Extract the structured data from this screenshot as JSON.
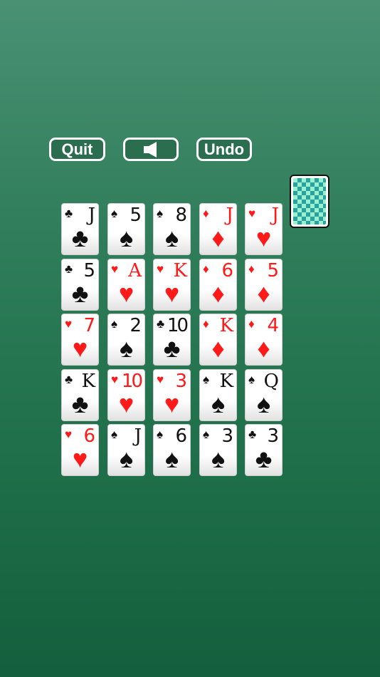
{
  "toolbar": {
    "quit_label": "Quit",
    "sound_icon": "speaker-icon",
    "undo_label": "Undo"
  },
  "deck": {
    "icon": "card-back-icon",
    "pattern_colors": [
      "#9bf0cf",
      "#2aa3a0"
    ]
  },
  "colors": {
    "red": "#ff1a1a",
    "black": "#111111",
    "felt": "#1e6e49"
  },
  "suit_symbols": {
    "clubs": "♣",
    "spades": "♠",
    "hearts": "♥",
    "diamonds": "♦"
  },
  "grid": [
    [
      {
        "rank": "J",
        "suit": "clubs"
      },
      {
        "rank": "5",
        "suit": "spades"
      },
      {
        "rank": "8",
        "suit": "spades"
      },
      {
        "rank": "J",
        "suit": "diamonds"
      },
      {
        "rank": "J",
        "suit": "hearts"
      }
    ],
    [
      {
        "rank": "5",
        "suit": "clubs"
      },
      {
        "rank": "A",
        "suit": "hearts"
      },
      {
        "rank": "K",
        "suit": "hearts"
      },
      {
        "rank": "6",
        "suit": "diamonds"
      },
      {
        "rank": "5",
        "suit": "diamonds"
      }
    ],
    [
      {
        "rank": "7",
        "suit": "hearts"
      },
      {
        "rank": "2",
        "suit": "spades"
      },
      {
        "rank": "10",
        "suit": "clubs"
      },
      {
        "rank": "K",
        "suit": "diamonds"
      },
      {
        "rank": "4",
        "suit": "diamonds"
      }
    ],
    [
      {
        "rank": "K",
        "suit": "clubs"
      },
      {
        "rank": "10",
        "suit": "hearts"
      },
      {
        "rank": "3",
        "suit": "hearts"
      },
      {
        "rank": "K",
        "suit": "spades"
      },
      {
        "rank": "Q",
        "suit": "spades"
      }
    ],
    [
      {
        "rank": "6",
        "suit": "hearts"
      },
      {
        "rank": "J",
        "suit": "spades"
      },
      {
        "rank": "6",
        "suit": "spades"
      },
      {
        "rank": "3",
        "suit": "spades"
      },
      {
        "rank": "3",
        "suit": "clubs"
      }
    ]
  ]
}
